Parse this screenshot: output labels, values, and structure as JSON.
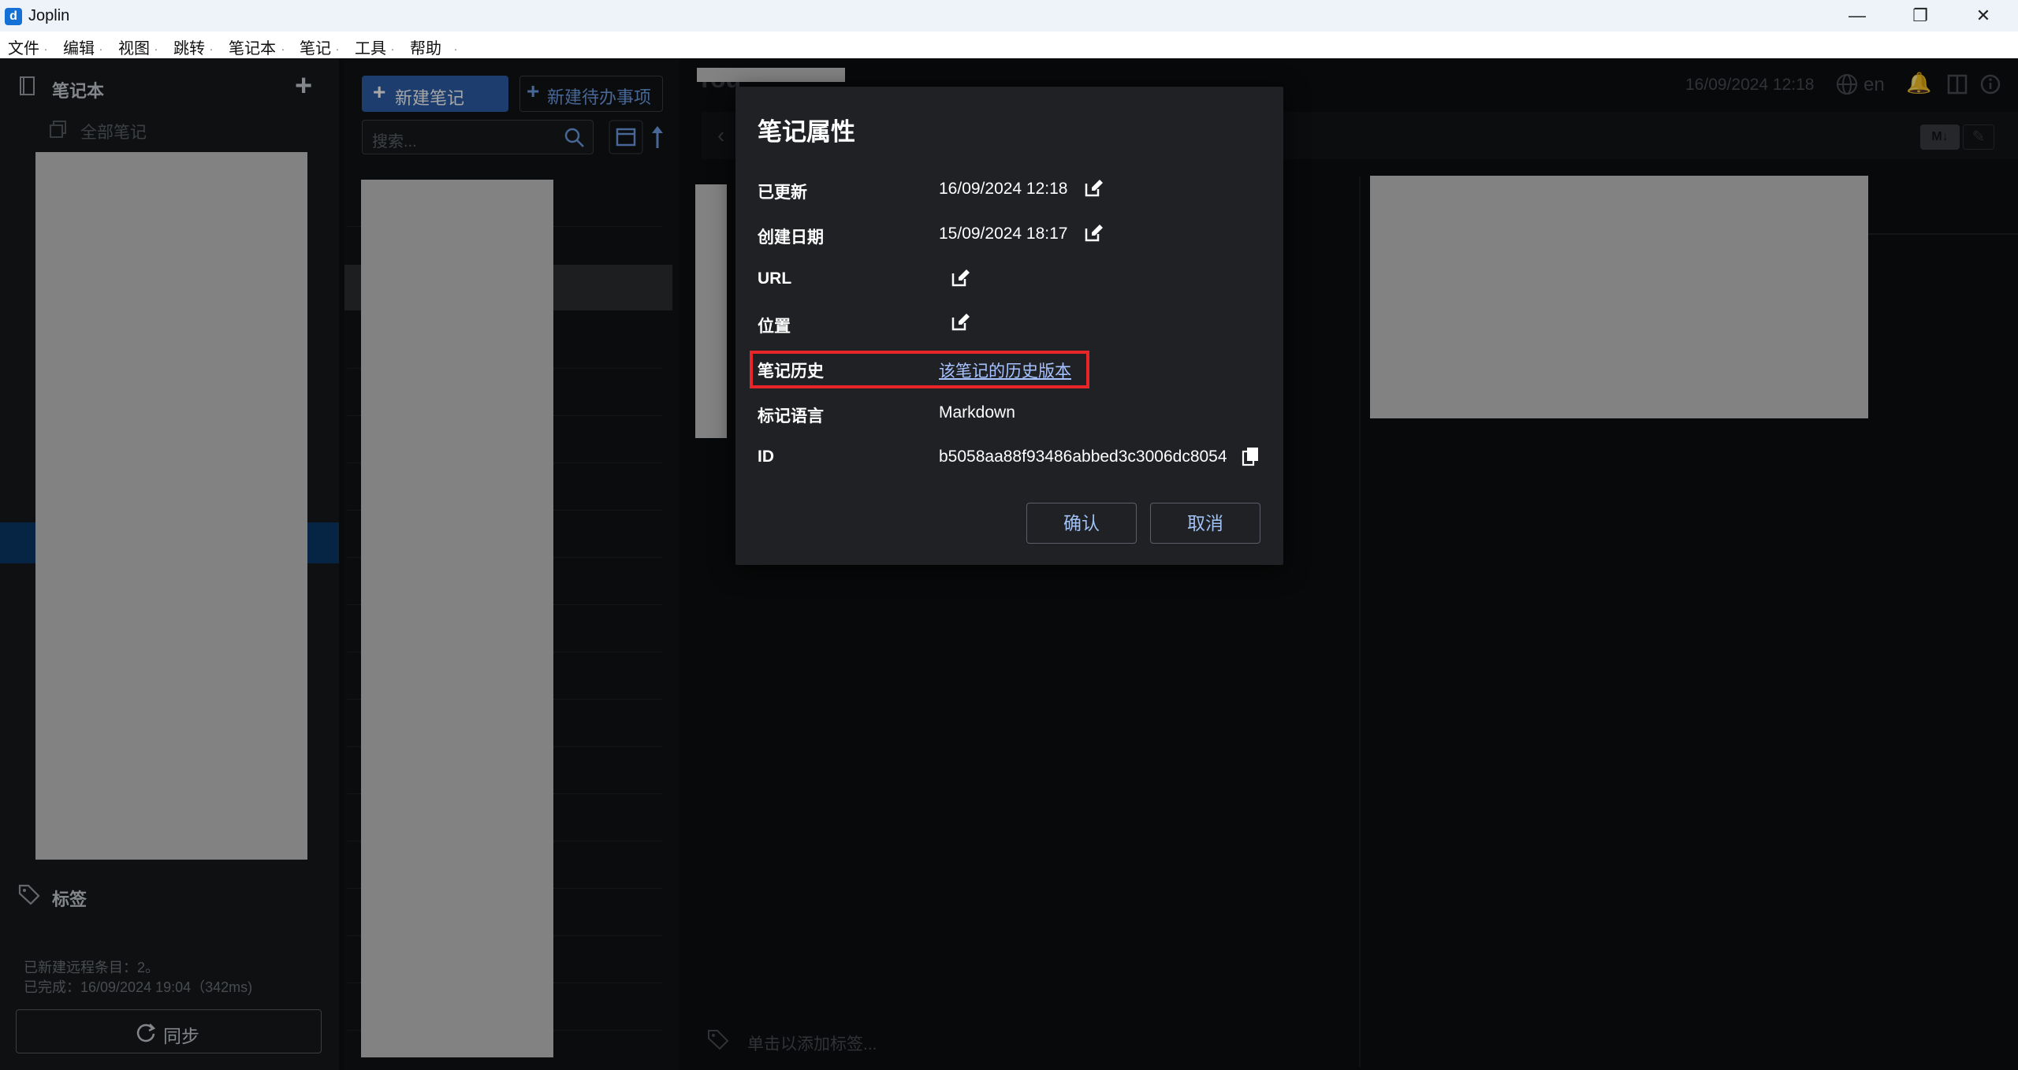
{
  "window": {
    "app_title": "Joplin",
    "app_icon_letter": "d"
  },
  "menu": {
    "items": [
      "文件",
      "编辑",
      "视图",
      "跳转",
      "笔记本",
      "笔记",
      "工具",
      "帮助"
    ]
  },
  "sidebar": {
    "notebooks_heading": "笔记本",
    "all_notes": "全部笔记",
    "tags_heading": "标签",
    "sync_status_line1": "已新建远程条目：2。",
    "sync_status_line2": "已完成：16/09/2024 19:04（342ms)",
    "sync_button": "同步"
  },
  "notelist": {
    "new_note": "新建笔记",
    "new_todo": "新建待办事项",
    "search_placeholder": "搜索..."
  },
  "editor": {
    "title_partial": "Tod",
    "date": "16/09/2024 12:18",
    "language": "en",
    "tags_placeholder": "单击以添加标签...",
    "markdown_badge": "M↓"
  },
  "dialog": {
    "title": "笔记属性",
    "rows": [
      {
        "label": "已更新",
        "value": "16/09/2024 12:18"
      },
      {
        "label": "创建日期",
        "value": "15/09/2024 18:17"
      },
      {
        "label": "URL",
        "value": ""
      },
      {
        "label": "位置",
        "value": ""
      },
      {
        "label": "笔记历史",
        "value": "该笔记的历史版本"
      },
      {
        "label": "标记语言",
        "value": "Markdown"
      },
      {
        "label": "ID",
        "value": "b5058aa88f93486abbed3c3006dc8054"
      }
    ],
    "confirm": "确认",
    "cancel": "取消"
  },
  "colors": {
    "accent": "#2c5fa8",
    "link": "#a7c3ff",
    "highlight_box": "#e8262a",
    "selected_notebook": "#0a3a6b"
  }
}
